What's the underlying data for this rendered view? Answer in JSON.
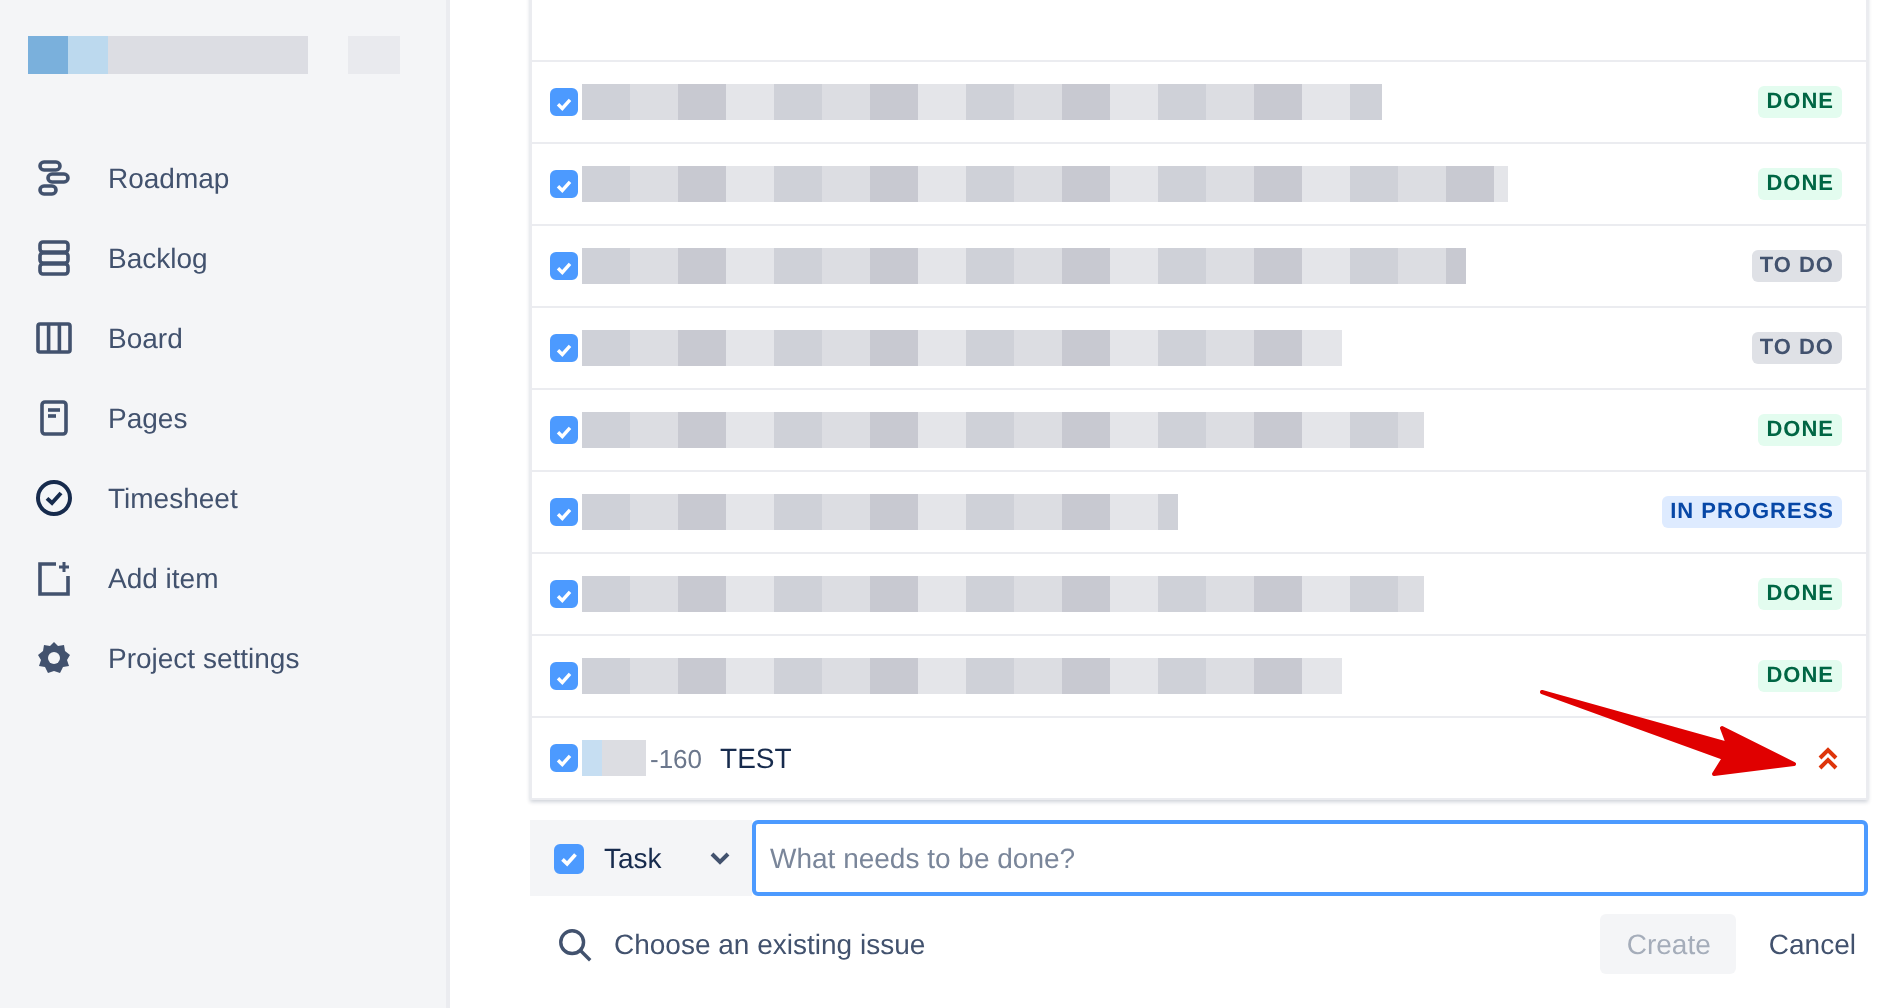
{
  "sidebar": {
    "items": [
      {
        "kind": "roadmap",
        "label": "Roadmap"
      },
      {
        "kind": "backlog",
        "label": "Backlog"
      },
      {
        "kind": "board",
        "label": "Board"
      },
      {
        "kind": "pages",
        "label": "Pages"
      },
      {
        "kind": "timesheet",
        "label": "Timesheet"
      },
      {
        "kind": "add",
        "label": "Add item"
      },
      {
        "kind": "settings",
        "label": "Project settings"
      }
    ]
  },
  "issues": [
    {
      "checked": true,
      "status": "DONE",
      "kind": "done"
    },
    {
      "checked": true,
      "status": "DONE",
      "kind": "done"
    },
    {
      "checked": true,
      "status": "TO DO",
      "kind": "todo"
    },
    {
      "checked": true,
      "status": "TO DO",
      "kind": "todo"
    },
    {
      "checked": true,
      "status": "DONE",
      "kind": "done"
    },
    {
      "checked": true,
      "status": "IN PROGRESS",
      "kind": "inprogress"
    },
    {
      "checked": true,
      "status": "DONE",
      "kind": "done"
    },
    {
      "checked": true,
      "status": "DONE",
      "kind": "done"
    }
  ],
  "new_issue": {
    "checked": true,
    "key": "-160",
    "summary": "TEST"
  },
  "create_form": {
    "type": "Task",
    "placeholder": "What needs to be done?",
    "link": "Choose an existing issue",
    "create_disabled": true,
    "create": "Create",
    "cancel": "Cancel"
  }
}
